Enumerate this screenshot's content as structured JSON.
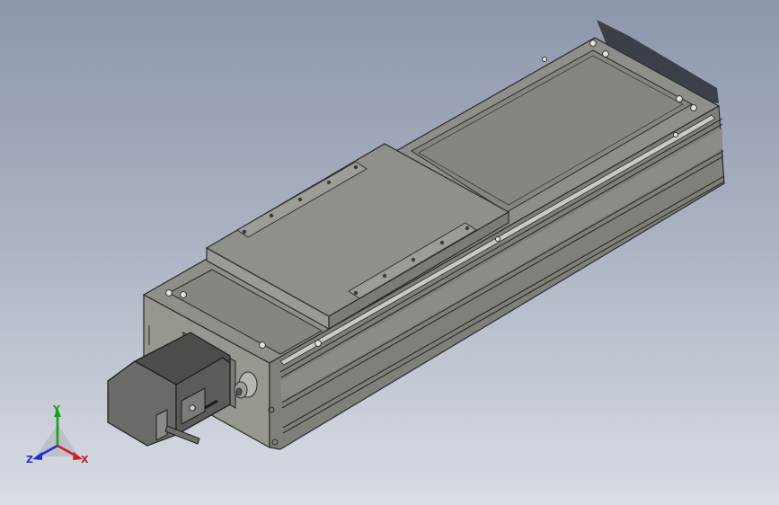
{
  "viewport": {
    "background_top": "#8d97ad",
    "background_bottom": "#d9dde4"
  },
  "model": {
    "description_icon": "linear-actuator-model",
    "body_color": "#8c8d87",
    "edge_color": "#2a2a2a"
  },
  "triad": {
    "x_label": "X",
    "y_label": "Y",
    "z_label": "Z",
    "x_color": "#d02020",
    "y_color": "#1aa01a",
    "z_color": "#2030d0"
  }
}
